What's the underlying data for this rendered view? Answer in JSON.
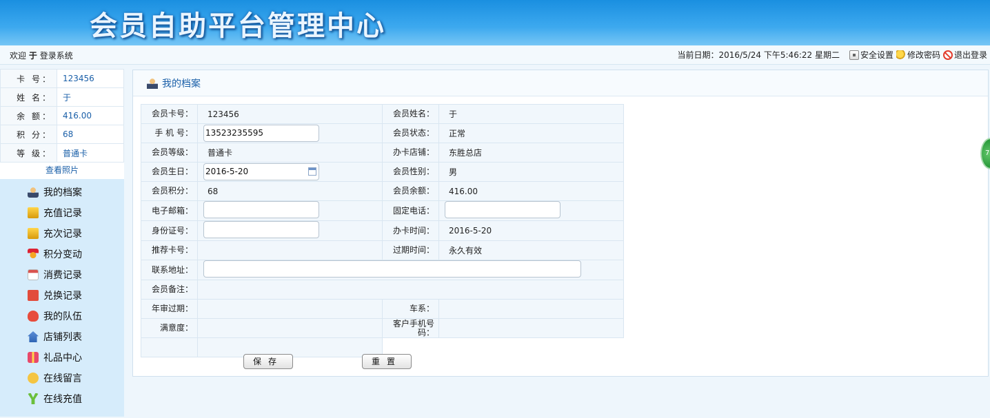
{
  "header": {
    "title": "会员自助平台管理中心"
  },
  "infobar": {
    "welcome_prefix": "欢迎",
    "user_name": "于",
    "welcome_suffix": "登录系统",
    "date_text": "当前日期：2016/5/24 下午5:46:22 星期二",
    "links": [
      {
        "label": "安全设置",
        "icon": "safe-icon"
      },
      {
        "label": "修改密码",
        "icon": "key-icon"
      },
      {
        "label": "退出登录",
        "icon": "exit-icon"
      }
    ]
  },
  "sidebar": {
    "info": [
      {
        "label": "卡 号：",
        "value": "123456"
      },
      {
        "label": "姓 名：",
        "value": "于"
      },
      {
        "label": "余 额：",
        "value": "416.00"
      },
      {
        "label": "积 分：",
        "value": "68"
      },
      {
        "label": "等 级：",
        "value": "普通卡"
      }
    ],
    "view_photo": "查看照片",
    "menu": [
      {
        "label": "我的档案",
        "icon": "user-icon"
      },
      {
        "label": "充值记录",
        "icon": "coins-icon"
      },
      {
        "label": "充次记录",
        "icon": "coins-icon"
      },
      {
        "label": "积分变动",
        "icon": "medal-icon"
      },
      {
        "label": "消费记录",
        "icon": "calendar-icon"
      },
      {
        "label": "兑换记录",
        "icon": "exchange-icon"
      },
      {
        "label": "我的队伍",
        "icon": "heart-icon"
      },
      {
        "label": "店铺列表",
        "icon": "home-icon"
      },
      {
        "label": "礼品中心",
        "icon": "gift-icon"
      },
      {
        "label": "在线留言",
        "icon": "chat-icon"
      },
      {
        "label": "在线充值",
        "icon": "yen-icon"
      }
    ]
  },
  "main": {
    "panel_title": "我的档案",
    "fields": {
      "card_no": {
        "label": "会员卡号：",
        "value": "123456"
      },
      "name": {
        "label": "会员姓名：",
        "value": "于"
      },
      "phone": {
        "label": "手 机 号：",
        "value": "13523235595"
      },
      "status": {
        "label": "会员状态：",
        "value": "正常"
      },
      "level": {
        "label": "会员等级：",
        "value": "普通卡"
      },
      "store": {
        "label": "办卡店铺：",
        "value": "东胜总店"
      },
      "birthday": {
        "label": "会员生日：",
        "value": "2016-5-20"
      },
      "gender": {
        "label": "会员性别：",
        "value": "男"
      },
      "points": {
        "label": "会员积分：",
        "value": "68"
      },
      "balance": {
        "label": "会员余额：",
        "value": "416.00"
      },
      "email": {
        "label": "电子邮箱：",
        "value": ""
      },
      "tel": {
        "label": "固定电话：",
        "value": ""
      },
      "id_no": {
        "label": "身份证号：",
        "value": ""
      },
      "open_time": {
        "label": "办卡时间：",
        "value": "2016-5-20"
      },
      "ref_card": {
        "label": "推荐卡号：",
        "value": ""
      },
      "expire": {
        "label": "过期时间：",
        "value": "永久有效"
      },
      "address": {
        "label": "联系地址：",
        "value": ""
      },
      "remark": {
        "label": "会员备注：",
        "value": ""
      },
      "inspect": {
        "label": "年审过期：",
        "value": ""
      },
      "car": {
        "label": "车系：",
        "value": ""
      },
      "satisfy": {
        "label": "满意度：",
        "value": ""
      },
      "cust_phone": {
        "label": "客户手机号码：",
        "value": ""
      }
    },
    "buttons": {
      "save": "保存",
      "reset": "重置"
    }
  },
  "float_badge": "7"
}
